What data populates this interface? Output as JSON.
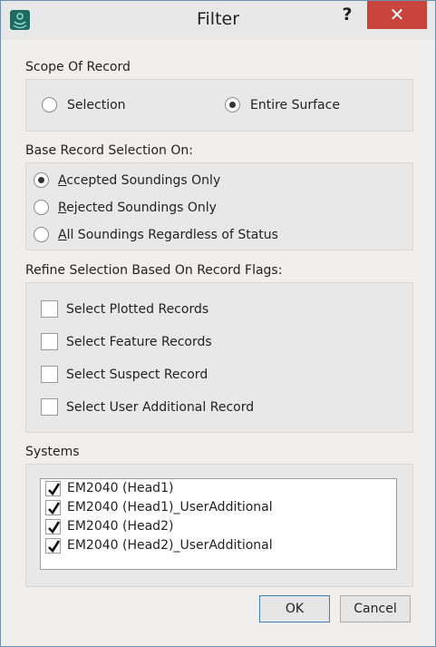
{
  "window": {
    "title": "Filter",
    "help_label": "?",
    "close_label": "✕"
  },
  "scope": {
    "label": "Scope Of Record",
    "options": [
      {
        "label": "Selection",
        "selected": false
      },
      {
        "label": "Entire Surface",
        "selected": true
      }
    ]
  },
  "base": {
    "label": "Base Record Selection On:",
    "options": [
      {
        "mnemonic": "A",
        "rest": "ccepted Soundings Only",
        "selected": true
      },
      {
        "mnemonic": "R",
        "rest": "ejected Soundings Only",
        "selected": false
      },
      {
        "mnemonic": "A",
        "rest": "ll Soundings Regardless of Status",
        "selected": false
      }
    ]
  },
  "refine": {
    "label": "Refine Selection Based On Record Flags:",
    "items": [
      {
        "label": "Select Plotted Records",
        "checked": false
      },
      {
        "label": "Select Feature Records",
        "checked": false
      },
      {
        "label": "Select Suspect Record",
        "checked": false
      },
      {
        "label": "Select User Additional Record",
        "checked": false
      }
    ]
  },
  "systems": {
    "label": "Systems",
    "items": [
      {
        "label": "EM2040 (Head1)",
        "checked": true
      },
      {
        "label": "EM2040 (Head1)_UserAdditional",
        "checked": true
      },
      {
        "label": "EM2040 (Head2)",
        "checked": true
      },
      {
        "label": "EM2040 (Head2)_UserAdditional",
        "checked": true
      }
    ]
  },
  "buttons": {
    "ok": "OK",
    "cancel": "Cancel"
  },
  "colors": {
    "close": "#c7453c",
    "accent": "#3c7fb1",
    "icon": "#1f6b63"
  }
}
